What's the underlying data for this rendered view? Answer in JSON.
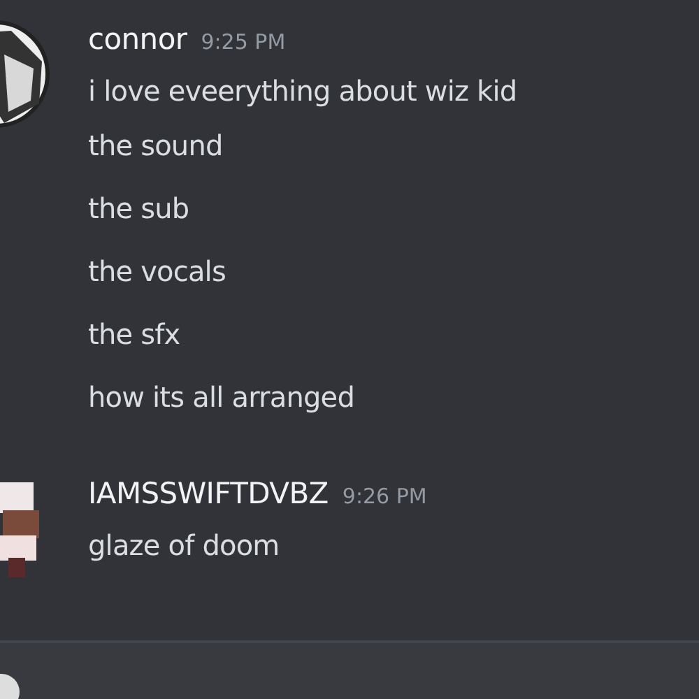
{
  "messages": [
    {
      "author": "connor",
      "time": "9:25 PM",
      "lines": [
        "i love eveerything about wiz kid",
        "the sound",
        "the sub",
        "the vocals",
        "the sfx",
        "how its all arranged"
      ]
    },
    {
      "author": "IAMSSWIFTDVBZ",
      "time": "9:26 PM",
      "lines": [
        "glaze of doom"
      ]
    }
  ]
}
